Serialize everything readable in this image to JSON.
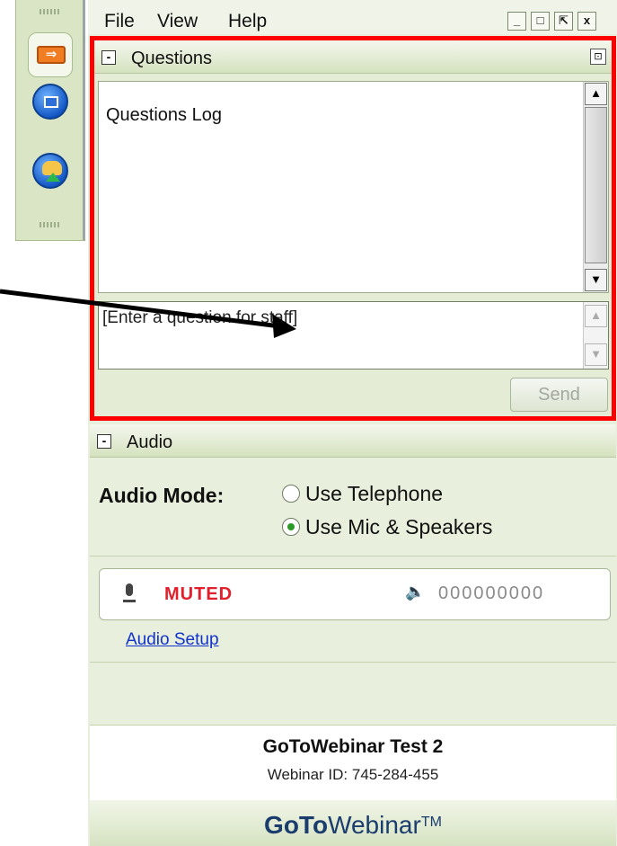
{
  "menu": {
    "file": "File",
    "view": "View",
    "help": "Help"
  },
  "window_buttons": {
    "minimize": "_",
    "maximize": "□",
    "popout": "⇱",
    "close": "x"
  },
  "questions": {
    "header": "Questions",
    "toggle": "-",
    "popout": "⊡",
    "log_title": "Questions Log",
    "input_placeholder": "[Enter a question for staff]",
    "send_label": "Send"
  },
  "audio": {
    "header": "Audio",
    "toggle": "-",
    "mode_label": "Audio Mode:",
    "option_telephone": "Use Telephone",
    "option_mic": "Use Mic & Speakers",
    "selected_option": "Use Mic & Speakers",
    "mute_status": "MUTED",
    "level_readout": "000000000",
    "setup_link": "Audio Setup"
  },
  "webinar": {
    "name": "GoToWebinar Test 2",
    "id_line": "Webinar ID: 745-284-455"
  },
  "brand": {
    "bold": "GoTo",
    "light": "Webinar",
    "tm": "TM"
  },
  "colors": {
    "highlight": "#ff0000",
    "muted": "#e2202c",
    "link": "#1133cc",
    "panel": "#e8efdc"
  }
}
